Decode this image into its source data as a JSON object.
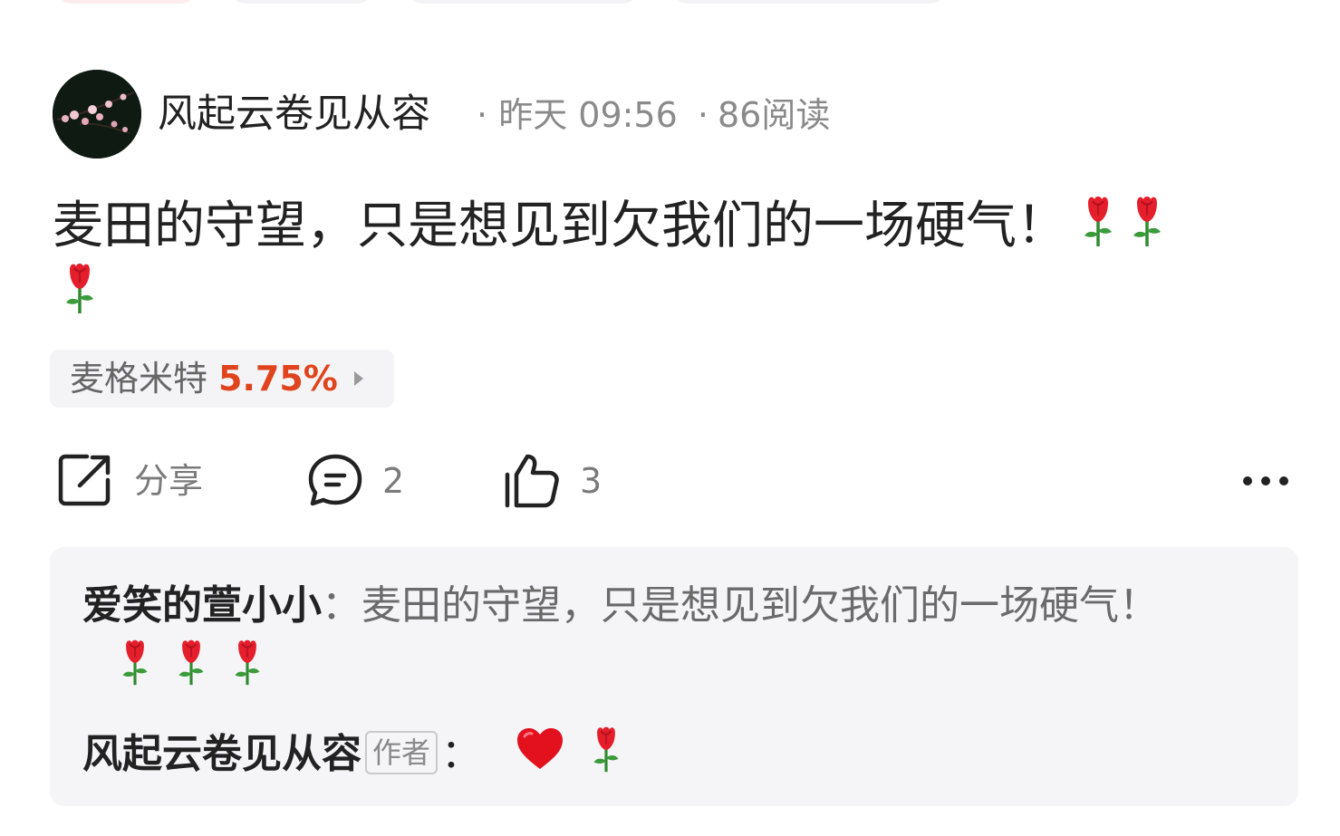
{
  "post": {
    "author": "风起云卷见从容",
    "time": "昨天 09:56",
    "reads": "86阅读",
    "separator": "·",
    "text": "麦田的守望，只是想见到欠我们的一场硬气！"
  },
  "stock": {
    "name": "麦格米特",
    "change": "5.75%"
  },
  "actions": {
    "share_label": "分享",
    "comment_count": "2",
    "like_count": "3"
  },
  "comments": [
    {
      "user": "爱笑的萱小小",
      "colon": "：",
      "text": "麦田的守望，只是想见到欠我们的一场硬气！"
    },
    {
      "user": "风起云卷见从容",
      "tag": "作者",
      "colon": "："
    }
  ],
  "icons": {
    "share": "share-icon",
    "comment": "comment-icon",
    "like": "thumbs-up-icon",
    "more": "more-icon",
    "rose": "rose-emoji",
    "heart": "heart-emoji"
  },
  "colors": {
    "accent": "#e0441c",
    "meta": "#8a8a8a",
    "card_bg": "#f5f5f8"
  }
}
